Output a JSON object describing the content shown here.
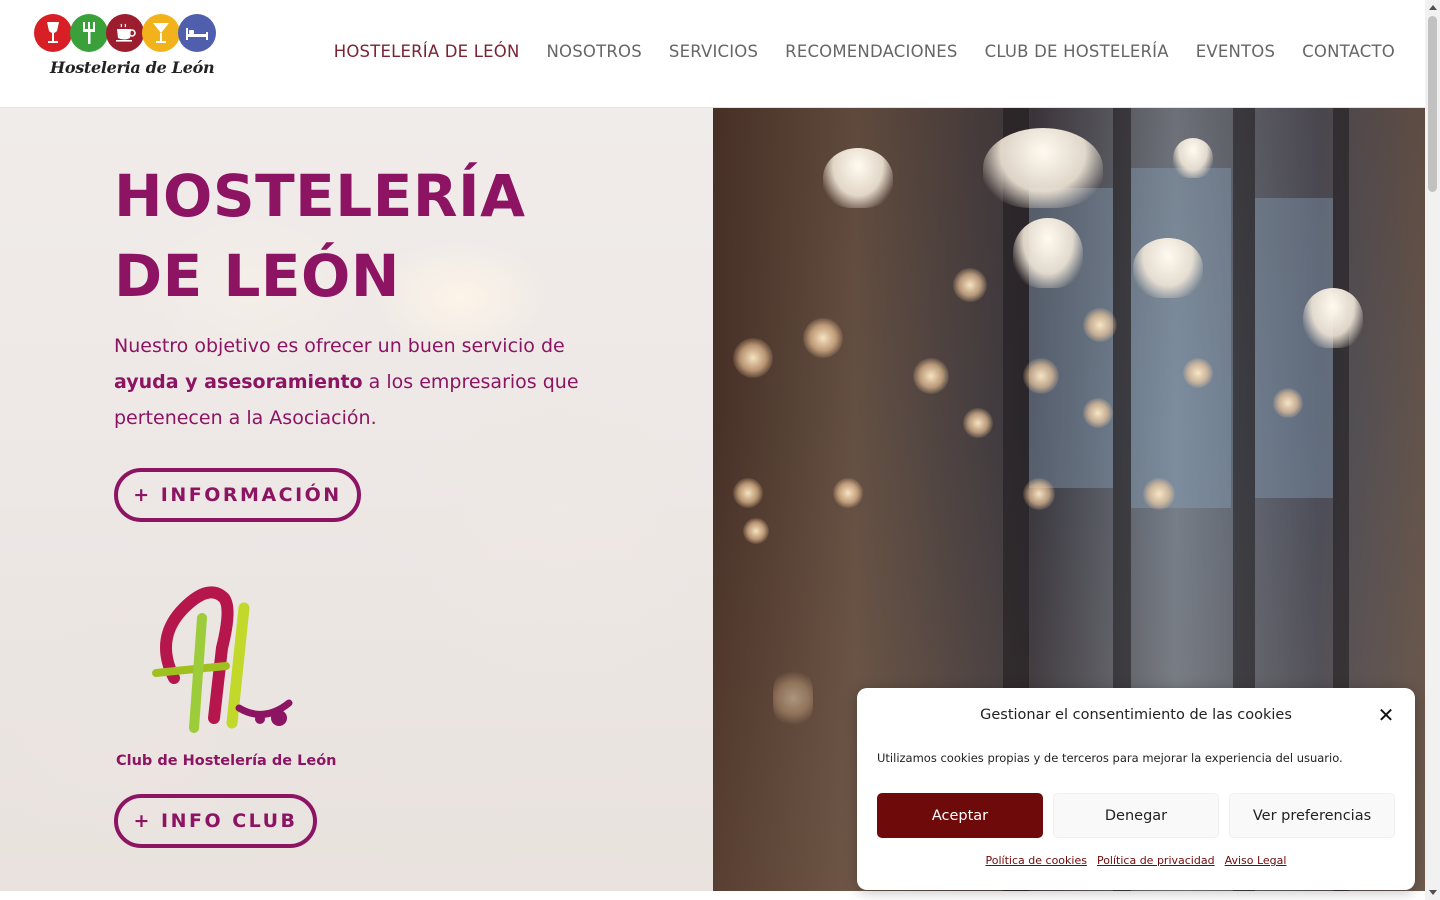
{
  "header": {
    "logo_text": "Hosteleria de León",
    "logo_icons": [
      "wine-glass-icon",
      "fork-icon",
      "coffee-cup-icon",
      "cocktail-icon",
      "bed-icon"
    ],
    "logo_colors": [
      "#d81f26",
      "#3aa03a",
      "#9c1d2e",
      "#f2b21b",
      "#4f5fae"
    ],
    "nav": [
      {
        "label": "HOSTELERÍA DE LEÓN",
        "active": true
      },
      {
        "label": "NOSOTROS"
      },
      {
        "label": "SERVICIOS"
      },
      {
        "label": "RECOMENDACIONES"
      },
      {
        "label": "CLUB DE HOSTELERÍA"
      },
      {
        "label": "EVENTOS"
      },
      {
        "label": "CONTACTO"
      }
    ]
  },
  "hero": {
    "title_line1": "HOSTELERÍA",
    "title_line2": "DE LEÓN",
    "text_part1": "Nuestro objetivo es ofrecer un buen servicio de",
    "text_bold": "ayuda y asesoramiento",
    "text_part2": "a los empresarios que pertenecen a la Asociación.",
    "info_button": "+ INFORMACIÓN",
    "club_caption": "Club de Hostelería de León",
    "club_button": "+ INFO CLUB"
  },
  "cookie": {
    "title": "Gestionar el consentimiento de las cookies",
    "message": "Utilizamos cookies propias y de terceros para mejorar la experiencia del usuario.",
    "accept": "Aceptar",
    "deny": "Denegar",
    "prefs": "Ver preferencias",
    "links": [
      "Política de cookies",
      "Política de privacidad",
      "Aviso Legal"
    ]
  },
  "colors": {
    "brand": "#8c1463",
    "nav_active": "#7a2431",
    "accept_button": "#6f0a0a"
  }
}
